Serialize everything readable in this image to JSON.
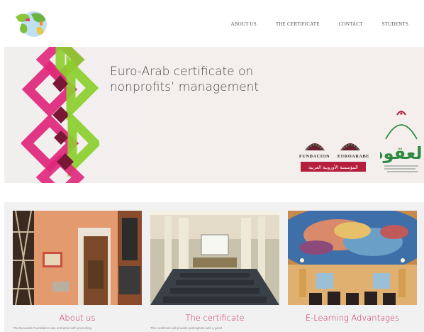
{
  "nav": {
    "items": [
      {
        "label": "ABOUT US"
      },
      {
        "label": "THE CERTIFICATE"
      },
      {
        "label": "CONTACT"
      },
      {
        "label": "STUDENTS"
      }
    ]
  },
  "hero": {
    "title_line1": "Euro-Arab certificate on",
    "title_line2": "nonprofits’ management",
    "partner_left_name1": "FUNDACION",
    "partner_left_name2": "EUROARABE",
    "partner_left_arabic": "المؤسسة الأوروبية العربية",
    "partner_right_arabic": "العقود"
  },
  "cards": [
    {
      "title": "About us",
      "text": "The Euroarab Foundation was entrusted with promoting"
    },
    {
      "title": "The certificate",
      "text": "This certificate will provide participants with a good"
    },
    {
      "title": "E-Learning Advantages",
      "text": ""
    }
  ],
  "colors": {
    "accent": "#c2245a",
    "diamond_pink": "#e0267a",
    "diamond_green": "#8ccf2e",
    "diamond_dark": "#7a1636"
  }
}
